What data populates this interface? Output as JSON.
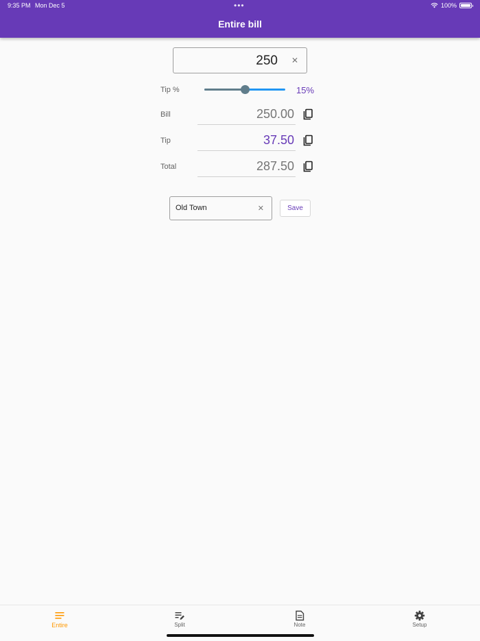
{
  "status_bar": {
    "time": "9:35 PM",
    "date": "Mon Dec 5",
    "battery": "100%"
  },
  "app_bar": {
    "title": "Entire bill"
  },
  "bill_input": {
    "value": "250"
  },
  "tip_slider": {
    "label": "Tip %",
    "value_text": "15%",
    "level": 0.5
  },
  "results": {
    "bill_label": "Bill",
    "bill_value": "250.00",
    "tip_label": "Tip",
    "tip_value": "37.50",
    "total_label": "Total",
    "total_value": "287.50"
  },
  "location": {
    "value": "Old Town",
    "save_label": "Save"
  },
  "bottom_nav": {
    "items": [
      {
        "label": "Entire",
        "icon": "lines-icon"
      },
      {
        "label": "Split",
        "icon": "edit-list-icon"
      },
      {
        "label": "Note",
        "icon": "note-icon"
      },
      {
        "label": "Setup",
        "icon": "gear-icon"
      }
    ]
  },
  "colors": {
    "primary": "#673ab7",
    "slider_inactive": "#2196f3",
    "slider_active": "#607d8b",
    "nav_active": "#ff9800"
  }
}
